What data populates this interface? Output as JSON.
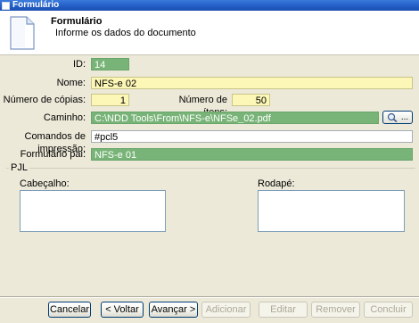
{
  "window": {
    "title": "Formulário"
  },
  "header": {
    "title": "Formulário",
    "subtitle": "Informe os dados do documento",
    "icon": "document-icon"
  },
  "form": {
    "id_label": "ID:",
    "id_value": "14",
    "name_label": "Nome:",
    "name_value": "NFS-e 02",
    "copies_label": "Número de cópias:",
    "copies_value": "1",
    "items_label": "Número de ítens:",
    "items_value": "50",
    "path_label": "Caminho:",
    "path_value": "C:\\NDD Tools\\From\\NFS-e\\NFSe_02.pdf",
    "browse_label": "...",
    "print_cmd_label": "Comandos de impressão:",
    "print_cmd_value": "#pcl5",
    "parent_label": "Formulário pai:",
    "parent_value": "NFS-e 01"
  },
  "pjl": {
    "group_label": "PJL",
    "header_label": "Cabeçalho:",
    "header_value": "",
    "footer_label": "Rodapé:",
    "footer_value": ""
  },
  "buttons": {
    "cancel": "Cancelar",
    "back": "< Voltar",
    "next": "Avançar >",
    "add": "Adicionar",
    "edit": "Editar",
    "remove": "Remover",
    "finish": "Concluir"
  },
  "colors": {
    "green_field": "#78b478",
    "yellow_field": "#fcf7b6",
    "titlebar": "#2460c8"
  }
}
